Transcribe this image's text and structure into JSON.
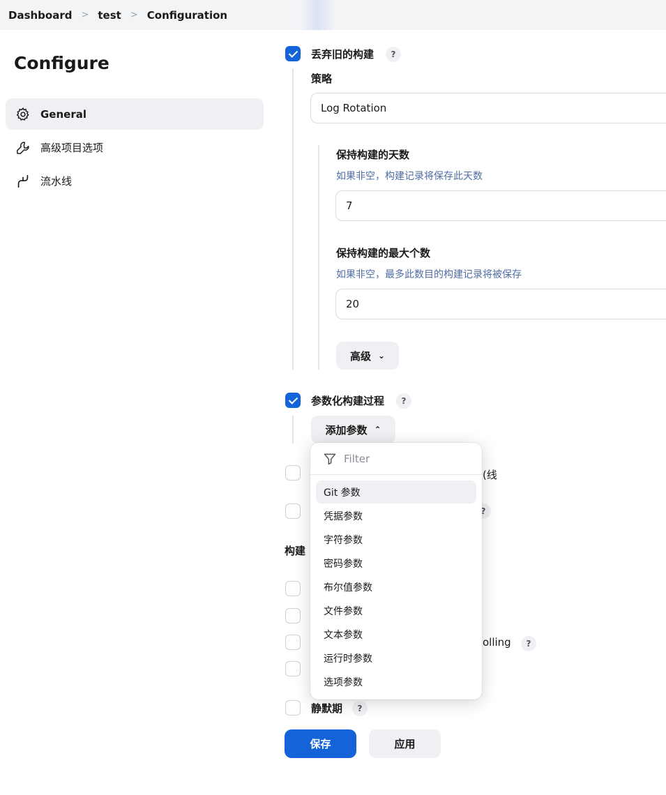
{
  "breadcrumb": {
    "items": [
      "Dashboard",
      "test",
      "Configuration"
    ]
  },
  "sidebar": {
    "title": "Configure",
    "items": [
      {
        "label": "General",
        "icon": "gear-icon",
        "active": true
      },
      {
        "label": "高级项目选项",
        "icon": "wrench-icon",
        "active": false
      },
      {
        "label": "流水线",
        "icon": "pipeline-icon",
        "active": false
      }
    ]
  },
  "discard_old_builds": {
    "label": "丢弃旧的构建",
    "checked": true,
    "strategy_label": "策略",
    "strategy_value": "Log Rotation",
    "days_label": "保持构建的天数",
    "days_desc": "如果非空，构建记录将保存此天数",
    "days_value": "7",
    "max_label": "保持构建的最大个数",
    "max_desc": "如果非空，最多此数目的构建记录将被保存",
    "max_value": "20",
    "advanced_label": "高级"
  },
  "parameterized": {
    "label": "参数化构建过程",
    "checked": true,
    "add_param_label": "添加参数"
  },
  "partial_labels": {
    "row1_tail": "线",
    "triggers_heading": "构建",
    "polling_tail": "olling"
  },
  "quiet_period": {
    "label": "静默期",
    "checked": false
  },
  "help_text": "?",
  "dropdown": {
    "filter_placeholder": "Filter",
    "items": [
      "Git 参数",
      "凭据参数",
      "字符参数",
      "密码参数",
      "布尔值参数",
      "文件参数",
      "文本参数",
      "运行时参数",
      "选项参数"
    ],
    "highlighted_index": 0
  },
  "footer": {
    "save_label": "保存",
    "apply_label": "应用"
  },
  "colors": {
    "accent": "#1463d9",
    "desc_text": "#4f6da3",
    "soft_bg": "#eef0f3"
  }
}
